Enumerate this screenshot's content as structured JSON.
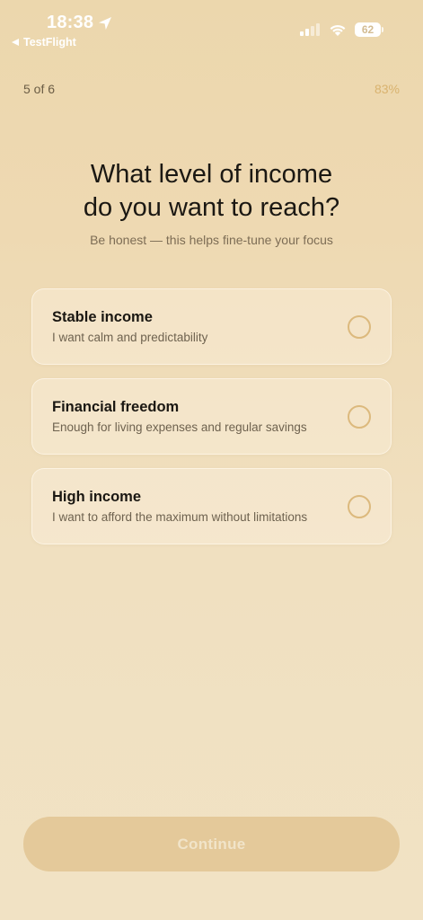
{
  "status_bar": {
    "time": "18:38",
    "back_app": "TestFlight",
    "battery": "62"
  },
  "progress": {
    "step": "5 of 6",
    "percent": "83%",
    "fraction": 0.83
  },
  "question": {
    "title": "What level of income\ndo you want to reach?",
    "subtitle": "Be honest — this helps fine-tune your focus"
  },
  "options": [
    {
      "title": "Stable income",
      "description": "I want calm and predictability",
      "selected": false
    },
    {
      "title": "Financial freedom",
      "description": "Enough for living expenses and regular savings",
      "selected": false
    },
    {
      "title": "High income",
      "description": "I want to afford the maximum without limitations",
      "selected": false
    }
  ],
  "continue_label": "Continue",
  "colors": {
    "accent": "#d9b36f",
    "button_disabled": "#e4c99a",
    "radio_border": "#dcb97d"
  },
  "icons": [
    "location-arrow-icon",
    "back-triangle-icon",
    "cellular-signal-icon",
    "wifi-icon",
    "battery-icon",
    "radio-unchecked-icon"
  ]
}
